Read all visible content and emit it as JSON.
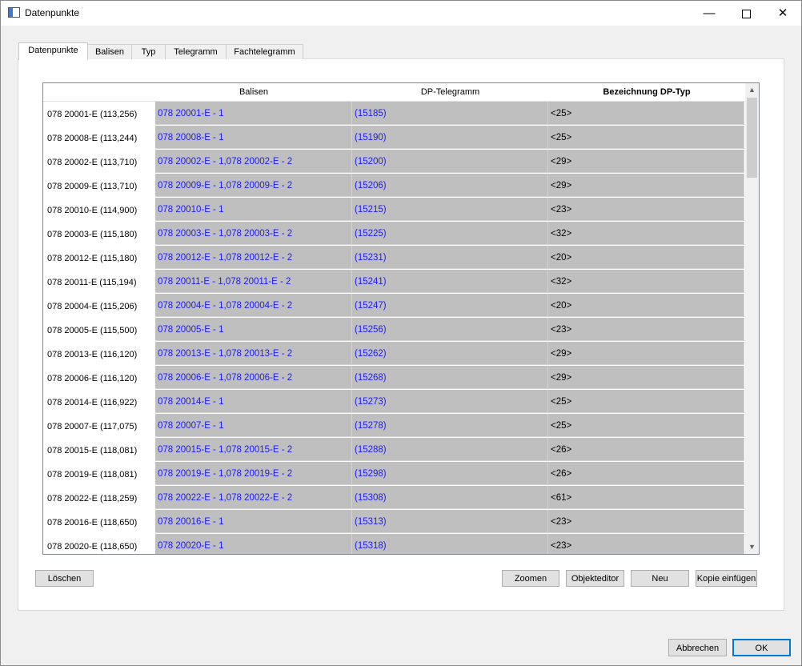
{
  "window": {
    "title": "Datenpunkte"
  },
  "tabs": [
    "Datenpunkte",
    "Balisen",
    "Typ",
    "Telegramm",
    "Fachtelegramm"
  ],
  "table": {
    "headers": [
      "Balisen",
      "DP-Telegramm",
      "Bezeichnung DP-Typ"
    ],
    "rows": [
      {
        "label": "078 20001-E (113,256)",
        "balisen": "078 20001-E - 1",
        "telegramm": "(15185)",
        "typ": "<25>"
      },
      {
        "label": "078 20008-E (113,244)",
        "balisen": "078 20008-E - 1",
        "telegramm": "(15190)",
        "typ": "<25>"
      },
      {
        "label": "078 20002-E (113,710)",
        "balisen": "078 20002-E - 1,078 20002-E - 2",
        "telegramm": "(15200)",
        "typ": "<29>"
      },
      {
        "label": "078 20009-E (113,710)",
        "balisen": "078 20009-E - 1,078 20009-E - 2",
        "telegramm": "(15206)",
        "typ": "<29>"
      },
      {
        "label": "078 20010-E (114,900)",
        "balisen": "078 20010-E - 1",
        "telegramm": "(15215)",
        "typ": "<23>"
      },
      {
        "label": "078 20003-E (115,180)",
        "balisen": "078 20003-E - 1,078 20003-E - 2",
        "telegramm": "(15225)",
        "typ": "<32>"
      },
      {
        "label": "078 20012-E (115,180)",
        "balisen": "078 20012-E - 1,078 20012-E - 2",
        "telegramm": "(15231)",
        "typ": "<20>"
      },
      {
        "label": "078 20011-E (115,194)",
        "balisen": "078 20011-E - 1,078 20011-E - 2",
        "telegramm": "(15241)",
        "typ": "<32>"
      },
      {
        "label": "078 20004-E (115,206)",
        "balisen": "078 20004-E - 1,078 20004-E - 2",
        "telegramm": "(15247)",
        "typ": "<20>"
      },
      {
        "label": "078 20005-E (115,500)",
        "balisen": "078 20005-E - 1",
        "telegramm": "(15256)",
        "typ": "<23>"
      },
      {
        "label": "078 20013-E (116,120)",
        "balisen": "078 20013-E - 1,078 20013-E - 2",
        "telegramm": "(15262)",
        "typ": "<29>"
      },
      {
        "label": "078 20006-E (116,120)",
        "balisen": "078 20006-E - 1,078 20006-E - 2",
        "telegramm": "(15268)",
        "typ": "<29>"
      },
      {
        "label": "078 20014-E (116,922)",
        "balisen": "078 20014-E - 1",
        "telegramm": "(15273)",
        "typ": "<25>"
      },
      {
        "label": "078 20007-E (117,075)",
        "balisen": "078 20007-E - 1",
        "telegramm": "(15278)",
        "typ": "<25>"
      },
      {
        "label": "078 20015-E (118,081)",
        "balisen": "078 20015-E - 1,078 20015-E - 2",
        "telegramm": "(15288)",
        "typ": "<26>"
      },
      {
        "label": "078 20019-E (118,081)",
        "balisen": "078 20019-E - 1,078 20019-E - 2",
        "telegramm": "(15298)",
        "typ": "<26>"
      },
      {
        "label": "078 20022-E (118,259)",
        "balisen": "078 20022-E - 1,078 20022-E - 2",
        "telegramm": "(15308)",
        "typ": "<61>"
      },
      {
        "label": "078 20016-E (118,650)",
        "balisen": "078 20016-E - 1",
        "telegramm": "(15313)",
        "typ": "<23>"
      },
      {
        "label": "078 20020-E (118,650)",
        "balisen": "078 20020-E - 1",
        "telegramm": "(15318)",
        "typ": "<23>"
      }
    ]
  },
  "buttons": {
    "delete": "Löschen",
    "zoom": "Zoomen",
    "object_editor": "Objekteditor",
    "new": "Neu",
    "paste_copy": "Kopie einfügen",
    "cancel": "Abbrechen",
    "ok": "OK"
  },
  "colors": {
    "cell_bg": "#bfbfbf",
    "link": "#1a1aff",
    "accent": "#0078d7"
  },
  "icons": [
    "app-icon",
    "minimize-icon",
    "maximize-icon",
    "close-icon",
    "scroll-up-icon",
    "scroll-down-icon"
  ]
}
